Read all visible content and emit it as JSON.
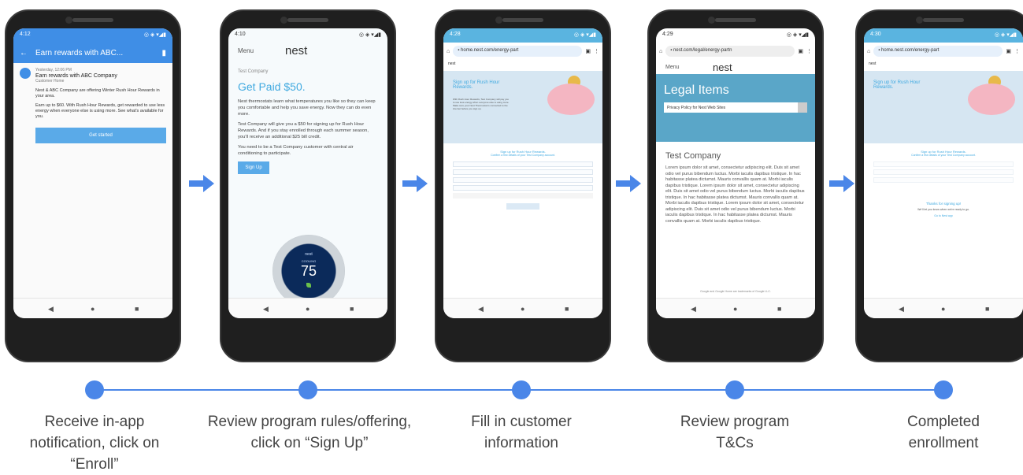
{
  "steps": [
    {
      "label_lines": [
        "Receive in-app",
        "notification, click on",
        "“Enroll”"
      ]
    },
    {
      "label_lines": [
        "Review program rules/offering,",
        "click on “Sign Up”"
      ]
    },
    {
      "label_lines": [
        "Fill in customer",
        "information"
      ]
    },
    {
      "label_lines": [
        "Review program",
        "T&Cs"
      ]
    },
    {
      "label_lines": [
        "Completed",
        "enrollment"
      ]
    }
  ],
  "phone1": {
    "time": "4:12",
    "appbar_title": "Earn rewards with ABC...",
    "date": "Yesterday, 12:06 PM",
    "title": "Earn rewards with ABC Company",
    "subtitle": "Customer Home",
    "para1": "Nest & ABC Company are offering Winter Rush Hour Rewards in your area.",
    "para2": "Earn up to $60. With Rush Hour Rewards, get rewarded to use less energy when everyone else is using more. See what's available for you.",
    "button": "Get started"
  },
  "phone2": {
    "time": "4:10",
    "menu": "Menu",
    "logo": "nest",
    "img_alt": "Test Company",
    "headline": "Get Paid $50.",
    "para1": "Nest thermostats learn what temperatures you like so they can keep you comfortable and help you save energy. Now they can do even more.",
    "para2": "Test Company will give you a $50 for signing up for Rush Hour Rewards. And if you stay enrolled through each summer season, you'll receive an additional $25 bill credit.",
    "para3": "You need to be a Test Company customer with central air conditioning to participate.",
    "button": "Sign Up",
    "thermostat_brand": "nest",
    "thermostat_mode": "COOLING",
    "thermostat_temp": "75"
  },
  "phone3": {
    "time": "4:28",
    "url": "home.nest.com/energy-part",
    "brand": "nest",
    "hero_title": "Sign up for Rush Hour Rewards.",
    "hero_text": "With Rush Hour Rewards, Test Company will pay you to use less energy when everyone else is using more. Make sure your Nest Thermostat is connected to the internet before you sign up.",
    "form_title": "Sign up for Rush Hour Rewards.",
    "form_sub": "Confirm a few details of your Test Company account."
  },
  "phone4": {
    "time": "4:29",
    "url": "nest.com/legal/energy-partn",
    "menu": "Menu",
    "logo": "nest",
    "banner_title": "Legal Items",
    "select_value": "Privacy Policy for Nest Web Sites",
    "company": "Test Company",
    "lorem": "Lorem ipsum dolor sit amet, consectetur adipiscing elit. Duis sit amet odio vel purus bibendum luctus. Morbi iaculis dapibus tristique. In hac habitasse platea dictumst. Mauris convallis quam at. Morbi iaculis dapibus tristique. Lorem ipsum dolor sit amet, consectetur adipiscing elit. Duis sit amet odio vel purus bibendum luctus. Morbi iaculis dapibus tristique. In hac habitasse platea dictumst. Mauris convallis quam at. Morbi iaculis dapibus tristique. Lorem ipsum dolor sit amet, consectetur adipiscing elit. Duis sit amet odio vel purus bibendum luctus. Morbi iaculis dapibus tristique. In hac habitasse platea dictumst. Mauris convallis quam at. Morbi iaculis dapibus tristique.",
    "footer": "Google and Google Home are trademarks of Google LLC."
  },
  "phone5": {
    "time": "4:30",
    "url": "home.nest.com/energy-part",
    "brand": "nest",
    "hero_title": "Sign up for Rush Hour Rewards.",
    "form_title": "Sign up for Rush Hour Rewards.",
    "form_sub": "Confirm a few details of your Test Company account.",
    "thanks": "Thanks for signing up!",
    "thanks_sub": "We'll let you know when we're ready to go.",
    "link": "Go to Nest app"
  },
  "colors": {
    "accent": "#4a86e8",
    "nest_blue": "#3fa9e0",
    "banner": "#5aa6c8"
  },
  "icons": {
    "arrow": "right-arrow-icon",
    "back": "back-arrow-icon",
    "delete": "trash-icon",
    "home": "home-icon",
    "lock": "lock-icon"
  }
}
